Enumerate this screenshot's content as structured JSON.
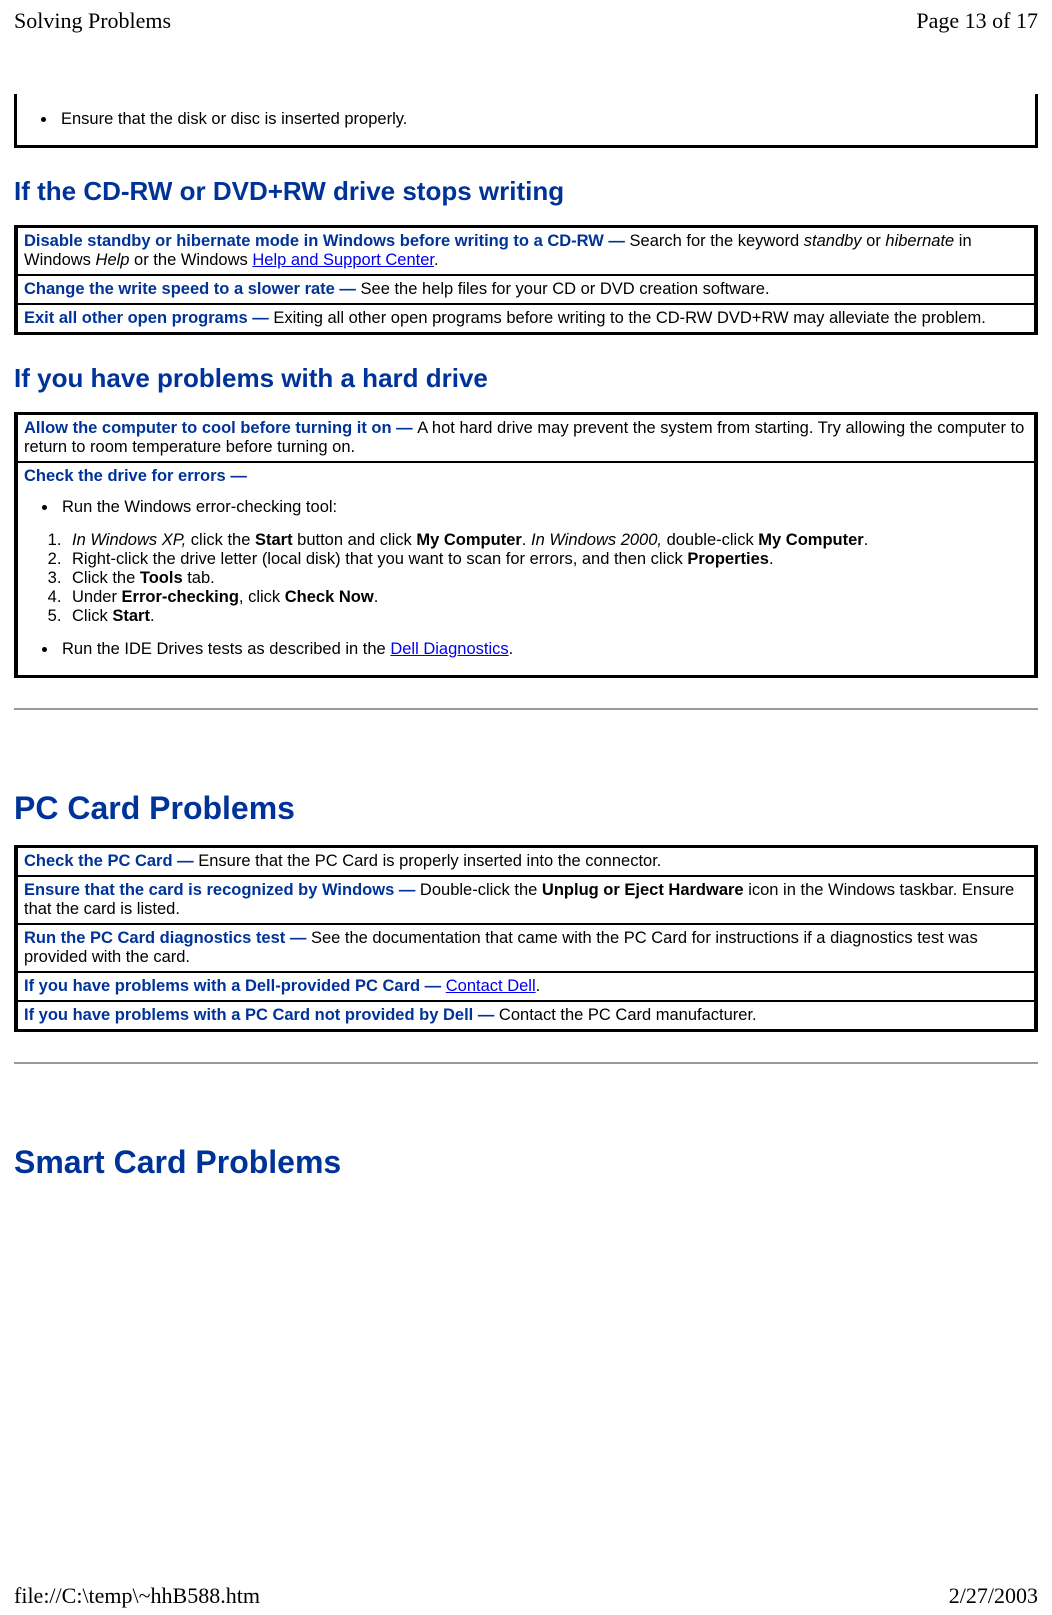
{
  "header": {
    "title": "Solving Problems",
    "pageinfo": "Page 13 of 17"
  },
  "footer": {
    "path": "file://C:\\temp\\~hhB588.htm",
    "date": "2/27/2003"
  },
  "top_bullet": "Ensure that the disk or disc is inserted properly.",
  "sec1": {
    "heading": "If the CD-RW or DVD+RW drive stops writing",
    "row1": {
      "lead": "Disable standby or hibernate mode in Windows before writing to a CD-RW — ",
      "t1": "Search for the keyword ",
      "i1": "standby",
      "t2": " or ",
      "i2": "hibernate",
      "t3": " in Windows ",
      "i3": "Help",
      "t4": " or the Windows ",
      "link": "Help and Support Center",
      "t5": "."
    },
    "row2": {
      "lead": "Change the write speed to a slower rate — ",
      "t": "See the help files for your CD or DVD creation software."
    },
    "row3": {
      "lead": "Exit all other open programs — ",
      "t": "Exiting all other open programs before writing to the CD-RW DVD+RW may alleviate the problem."
    }
  },
  "sec2": {
    "heading": "If you have problems with a hard drive",
    "row1": {
      "lead": "Allow the computer to cool before turning it on — ",
      "t": "A hot hard drive may prevent the system from starting. Try allowing the computer to return to room temperature before turning on."
    },
    "row2": {
      "lead": "Check the drive for errors — ",
      "b1": "Run the Windows error-checking tool:",
      "ol1": {
        "i1": "In Windows XP,",
        "t1": " click the ",
        "b1a": "Start",
        "t1a": " button and click ",
        "b1b": "My Computer",
        "t1b": ". ",
        "i1b": "In Windows 2000,",
        "t1c": " double-click ",
        "b1c": "My Computer",
        "t1d": "."
      },
      "ol2": {
        "t1": "Right-click the drive letter (local disk) that you want to scan for errors, and then click ",
        "b": "Properties",
        "t2": "."
      },
      "ol3": {
        "t1": "Click the ",
        "b": "Tools",
        "t2": " tab."
      },
      "ol4": {
        "t1": "Under ",
        "b1": "Error-checking",
        "t2": ", click ",
        "b2": "Check Now",
        "t3": "."
      },
      "ol5": {
        "t1": "Click ",
        "b": "Start",
        "t2": "."
      },
      "b2a": "Run the IDE Drives tests as described in the ",
      "link": "Dell Diagnostics",
      "b2b": "."
    }
  },
  "sec3": {
    "heading": "PC Card Problems",
    "row1": {
      "lead": "Check the PC Card — ",
      "t": "Ensure that the PC Card is properly inserted into the connector."
    },
    "row2": {
      "lead": "Ensure that the card is recognized by Windows — ",
      "t1": "Double-click the ",
      "b": "Unplug or Eject Hardware",
      "t2": " icon in the Windows taskbar. Ensure that the card is listed."
    },
    "row3": {
      "lead": "Run the PC Card diagnostics test — ",
      "t": "See the documentation that came with the PC Card for instructions if a diagnostics test was provided with the card."
    },
    "row4": {
      "lead": "If you have problems with a Dell-provided PC Card — ",
      "link": "Contact Dell",
      "t": "."
    },
    "row5": {
      "lead": "If you have problems with a PC Card not provided by Dell — ",
      "t": "Contact the PC Card manufacturer."
    }
  },
  "sec4": {
    "heading": "Smart Card Problems"
  }
}
